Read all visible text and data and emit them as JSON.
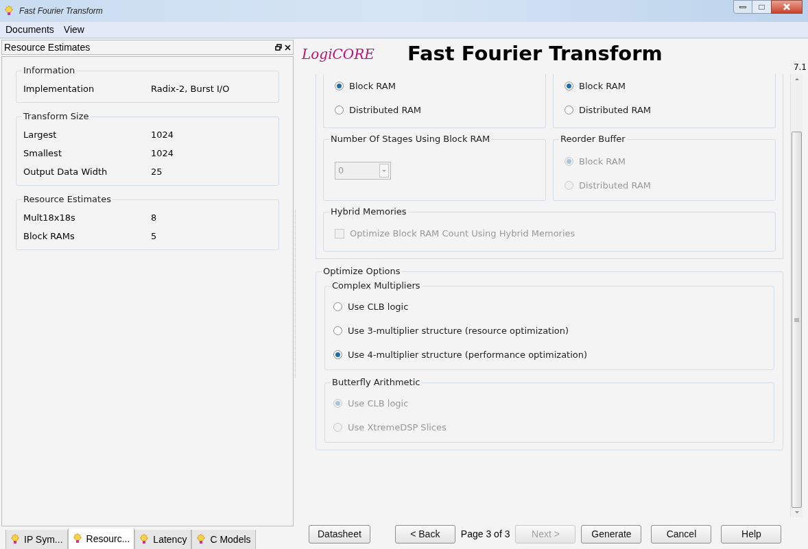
{
  "window": {
    "title": "Fast Fourier Transform"
  },
  "menu": [
    "Documents",
    "View"
  ],
  "left_panel": {
    "title": "Resource Estimates",
    "sections": [
      {
        "title": "Information",
        "rows": [
          {
            "label": "Implementation",
            "value": "Radix-2, Burst I/O"
          }
        ]
      },
      {
        "title": "Transform Size",
        "rows": [
          {
            "label": "Largest",
            "value": "1024"
          },
          {
            "label": "Smallest",
            "value": "1024"
          },
          {
            "label": "Output Data Width",
            "value": "25"
          }
        ]
      },
      {
        "title": "Resource Estimates",
        "rows": [
          {
            "label": "Mult18x18s",
            "value": "8"
          },
          {
            "label": "Block RAMs",
            "value": "5"
          }
        ]
      }
    ]
  },
  "bottom_tabs": [
    {
      "label": "IP Sym...",
      "selected": false
    },
    {
      "label": "Resourc...",
      "selected": true
    },
    {
      "label": "Latency",
      "selected": false
    },
    {
      "label": "C Models",
      "selected": false
    }
  ],
  "header": {
    "logo": "LogiCORE",
    "title": "Fast Fourier Transform",
    "version": "7.1"
  },
  "memory_rows": [
    [
      {
        "kind": "radio",
        "options": [
          {
            "label": "Block RAM",
            "selected": true,
            "disabled": false
          },
          {
            "label": "Distributed RAM",
            "selected": false,
            "disabled": false
          }
        ]
      },
      {
        "kind": "radio",
        "options": [
          {
            "label": "Block RAM",
            "selected": true,
            "disabled": false
          },
          {
            "label": "Distributed RAM",
            "selected": false,
            "disabled": false
          }
        ]
      }
    ],
    [
      {
        "kind": "dropdown",
        "title": "Number Of Stages Using Block RAM",
        "value": "0",
        "disabled": true
      },
      {
        "kind": "radio",
        "title": "Reorder Buffer",
        "options": [
          {
            "label": "Block RAM",
            "selected": true,
            "disabled": true
          },
          {
            "label": "Distributed RAM",
            "selected": false,
            "disabled": true
          }
        ]
      }
    ],
    [
      {
        "kind": "checkbox",
        "title": "Hybrid Memories",
        "label": "Optimize Block RAM Count Using Hybrid Memories",
        "checked": false,
        "disabled": true
      }
    ]
  ],
  "optimize": {
    "title": "Optimize Options",
    "groups": [
      {
        "title": "Complex Multipliers",
        "options": [
          {
            "label": "Use CLB logic",
            "selected": false,
            "disabled": false
          },
          {
            "label": "Use 3-multiplier structure (resource optimization)",
            "selected": false,
            "disabled": false
          },
          {
            "label": "Use 4-multiplier structure (performance optimization)",
            "selected": true,
            "disabled": false
          }
        ]
      },
      {
        "title": "Butterfly Arithmetic",
        "options": [
          {
            "label": "Use CLB logic",
            "selected": true,
            "disabled": true
          },
          {
            "label": "Use XtremeDSP Slices",
            "selected": false,
            "disabled": true
          }
        ]
      }
    ]
  },
  "footer": {
    "datasheet": "Datasheet",
    "back": "< Back",
    "page": "Page 3 of 3",
    "next": {
      "label": "Next >",
      "disabled": true
    },
    "buttons": [
      "Generate",
      "Cancel",
      "Help"
    ]
  }
}
